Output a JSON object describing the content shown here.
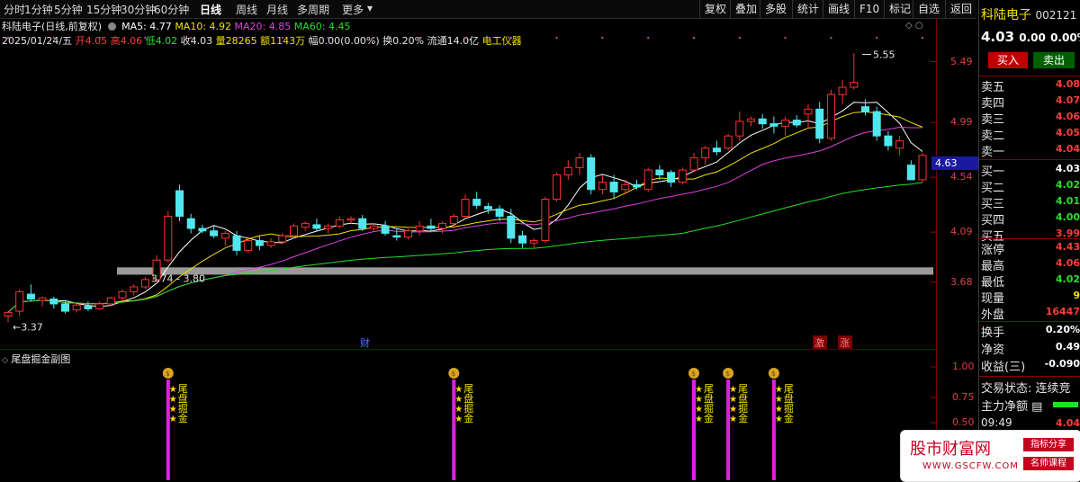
{
  "toolbar": {
    "periods": [
      "分时",
      "1分钟",
      "5分钟",
      "15分钟",
      "30分钟",
      "60分钟",
      "日线",
      "周线",
      "月线",
      "多周期",
      "更多"
    ],
    "active_period": "日线",
    "tools": [
      "复权",
      "叠加",
      "多股",
      "统计",
      "画线",
      "F10",
      "标记",
      "自选",
      "返回"
    ]
  },
  "header": {
    "stock_title": "科陆电子(日线,前复权)",
    "ma": [
      {
        "label": "MA5: 4.77",
        "color": "#ffffff"
      },
      {
        "label": "MA10: 4.92",
        "color": "#f0e000"
      },
      {
        "label": "MA20: 4.85",
        "color": "#e040e0"
      },
      {
        "label": "MA60: 4.45",
        "color": "#24e024"
      }
    ],
    "ohlc_line": {
      "date": "2025/01/24/五",
      "open": "开4.05",
      "high": "高4.06",
      "low": "低4.02",
      "close": "收4.03",
      "volume": "量28265",
      "amount": "额1143万",
      "amplitude": "幅0.00(0.00%)",
      "turnover": "换0.20%",
      "float": "流通14.0亿",
      "industry": "电工仪器"
    }
  },
  "price_axis": [
    "5.49",
    "4.99",
    "4.54",
    "4.09",
    "3.68"
  ],
  "current_price_tag": "4.63",
  "annotations": {
    "high_mark": "5.55",
    "low_mark": "←3.37",
    "support_band": "3.74 - 3.80",
    "event_cai": "财",
    "event_ji": "激",
    "event_zhang": "涨"
  },
  "sub_chart": {
    "title": "尾盘掘金副图",
    "axis": [
      "1.00",
      "0.75",
      "0.50"
    ],
    "signal_chars": [
      "尾",
      "盘",
      "掘",
      "金"
    ],
    "signal_count": 5
  },
  "chart_data": {
    "type": "candlestick",
    "ylim": [
      3.3,
      5.62
    ],
    "candles": [
      [
        3.4,
        3.44,
        3.35,
        3.43
      ],
      [
        3.44,
        3.62,
        3.4,
        3.6
      ],
      [
        3.58,
        3.66,
        3.52,
        3.54
      ],
      [
        3.53,
        3.56,
        3.48,
        3.55
      ],
      [
        3.54,
        3.56,
        3.46,
        3.5
      ],
      [
        3.5,
        3.53,
        3.42,
        3.44
      ],
      [
        3.45,
        3.5,
        3.43,
        3.49
      ],
      [
        3.48,
        3.52,
        3.44,
        3.46
      ],
      [
        3.46,
        3.52,
        3.45,
        3.5
      ],
      [
        3.5,
        3.56,
        3.48,
        3.55
      ],
      [
        3.55,
        3.62,
        3.52,
        3.6
      ],
      [
        3.6,
        3.66,
        3.57,
        3.64
      ],
      [
        3.64,
        3.72,
        3.62,
        3.7
      ],
      [
        3.7,
        3.9,
        3.68,
        3.86
      ],
      [
        3.86,
        4.26,
        3.84,
        4.22
      ],
      [
        4.43,
        4.48,
        4.18,
        4.22
      ],
      [
        4.2,
        4.24,
        4.08,
        4.12
      ],
      [
        4.12,
        4.15,
        4.08,
        4.1
      ],
      [
        4.1,
        4.14,
        4.04,
        4.06
      ],
      [
        4.04,
        4.1,
        3.98,
        4.08
      ],
      [
        4.06,
        4.1,
        3.9,
        3.94
      ],
      [
        3.94,
        4.05,
        3.92,
        4.02
      ],
      [
        4.02,
        4.06,
        3.94,
        3.98
      ],
      [
        3.98,
        4.04,
        3.96,
        4.01
      ],
      [
        4.01,
        4.08,
        3.99,
        4.06
      ],
      [
        4.06,
        4.16,
        4.04,
        4.14
      ],
      [
        4.13,
        4.18,
        4.1,
        4.16
      ],
      [
        4.15,
        4.2,
        4.1,
        4.12
      ],
      [
        4.12,
        4.16,
        4.08,
        4.14
      ],
      [
        4.14,
        4.22,
        4.12,
        4.19
      ],
      [
        4.19,
        4.22,
        4.16,
        4.2
      ],
      [
        4.2,
        4.23,
        4.1,
        4.12
      ],
      [
        4.12,
        4.16,
        4.09,
        4.14
      ],
      [
        4.14,
        4.18,
        4.06,
        4.08
      ],
      [
        4.06,
        4.12,
        4.02,
        4.05
      ],
      [
        4.05,
        4.12,
        4.03,
        4.1
      ],
      [
        4.1,
        4.18,
        4.06,
        4.14
      ],
      [
        4.14,
        4.2,
        4.1,
        4.12
      ],
      [
        4.12,
        4.18,
        4.08,
        4.16
      ],
      [
        4.16,
        4.24,
        4.12,
        4.22
      ],
      [
        4.22,
        4.4,
        4.2,
        4.36
      ],
      [
        4.36,
        4.42,
        4.28,
        4.31
      ],
      [
        4.3,
        4.33,
        4.24,
        4.28
      ],
      [
        4.28,
        4.31,
        4.18,
        4.22
      ],
      [
        4.22,
        4.28,
        4.0,
        4.04
      ],
      [
        4.06,
        4.1,
        3.96,
        4.0
      ],
      [
        4.0,
        4.04,
        3.96,
        4.02
      ],
      [
        4.02,
        4.38,
        4.0,
        4.36
      ],
      [
        4.36,
        4.58,
        4.34,
        4.56
      ],
      [
        4.56,
        4.68,
        4.52,
        4.62
      ],
      [
        4.62,
        4.74,
        4.56,
        4.7
      ],
      [
        4.7,
        4.73,
        4.4,
        4.44
      ],
      [
        4.44,
        4.56,
        4.4,
        4.5
      ],
      [
        4.5,
        4.56,
        4.36,
        4.42
      ],
      [
        4.44,
        4.52,
        4.4,
        4.48
      ],
      [
        4.48,
        4.52,
        4.44,
        4.46
      ],
      [
        4.44,
        4.62,
        4.42,
        4.6
      ],
      [
        4.6,
        4.64,
        4.52,
        4.56
      ],
      [
        4.58,
        4.6,
        4.46,
        4.5
      ],
      [
        4.5,
        4.62,
        4.48,
        4.6
      ],
      [
        4.6,
        4.74,
        4.58,
        4.7
      ],
      [
        4.7,
        4.8,
        4.64,
        4.78
      ],
      [
        4.78,
        4.84,
        4.72,
        4.75
      ],
      [
        4.78,
        4.9,
        4.76,
        4.88
      ],
      [
        4.88,
        5.08,
        4.84,
        5.0
      ],
      [
        5.0,
        5.04,
        4.96,
        5.02
      ],
      [
        5.02,
        5.06,
        4.94,
        4.98
      ],
      [
        4.98,
        5.04,
        4.9,
        4.96
      ],
      [
        4.96,
        5.04,
        4.88,
        5.01
      ],
      [
        5.01,
        5.05,
        4.95,
        4.97
      ],
      [
        5.06,
        5.14,
        4.94,
        5.1
      ],
      [
        5.1,
        5.16,
        4.82,
        4.86
      ],
      [
        4.86,
        5.26,
        4.84,
        5.22
      ],
      [
        5.22,
        5.34,
        5.14,
        5.28
      ],
      [
        5.28,
        5.56,
        5.26,
        5.32
      ],
      [
        5.12,
        5.18,
        5.05,
        5.08
      ],
      [
        5.08,
        5.12,
        4.84,
        4.88
      ],
      [
        4.88,
        4.92,
        4.76,
        4.8
      ],
      [
        4.78,
        4.88,
        4.72,
        4.84
      ],
      [
        4.64,
        4.68,
        4.52,
        4.52
      ],
      [
        4.52,
        4.74,
        4.5,
        4.72
      ]
    ],
    "signal_positions": [
      14,
      39,
      60,
      63,
      67
    ]
  }
}
